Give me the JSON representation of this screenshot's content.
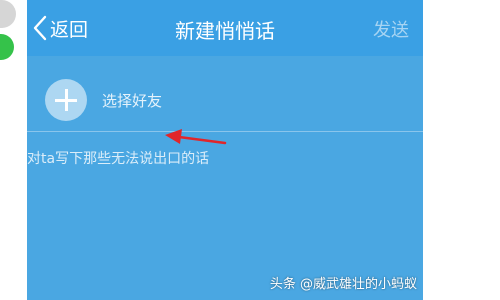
{
  "header": {
    "back_label": "返回",
    "title": "新建悄悄话",
    "send_label": "发送"
  },
  "friend_picker": {
    "label": "选择好友"
  },
  "message": {
    "placeholder": "对ta写下那些无法说出口的话",
    "value": ""
  },
  "watermark": "头条 @威武雄壮的小蚂蚁",
  "colors": {
    "phone_bg": "#4aa7e2",
    "titlebar_bg": "#3aa0e4",
    "annotation_arrow": "#e0262b"
  }
}
